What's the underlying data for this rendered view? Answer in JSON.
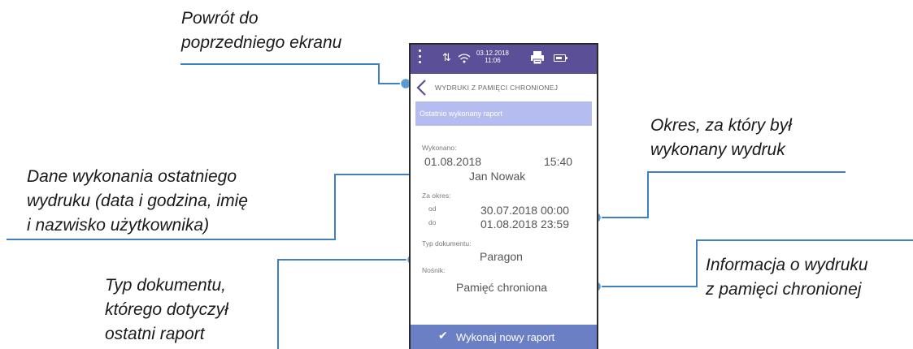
{
  "callouts": {
    "back_1": "Powrót do",
    "back_2": "poprzedniego ekranu",
    "period_1": "Okres, za który był",
    "period_2": "wykonany wydruk",
    "last_1": "Dane wykonania ostatniego",
    "last_2": "wydruku (data i godzina, imię",
    "last_3": "i nazwisko użytkownika)",
    "info_1": "Informacja o wydruku",
    "info_2": "z pamięci chronionej",
    "doctype_1": "Typ dokumentu,",
    "doctype_2": "którego dotyczył",
    "doctype_3": "ostatni raport"
  },
  "statusbar": {
    "date": "03.12.2018",
    "time": "11:06",
    "icons": [
      "menu-icon",
      "data-transfer-icon",
      "wifi-icon",
      "printer-icon",
      "battery-icon"
    ]
  },
  "screen": {
    "title": "WYDRUKI Z PAMIĘCI CHRONIONEJ",
    "section_header": "Ostatnio wykonany raport",
    "executed_label": "Wykonano:",
    "executed_date": "01.08.2018",
    "executed_time": "15:40",
    "user": "Jan Nowak",
    "period_label": "Za okres:",
    "from_label": "od",
    "from_value": "30.07.2018 00:00",
    "to_label": "do",
    "to_value": "01.08.2018 23:59",
    "doc_type_label": "Typ dokumentu:",
    "doc_type_value": "Paragon",
    "medium_label": "Nośnik:",
    "medium_value": "Pamięć chroniona",
    "action_button": "Wykonaj nowy raport"
  },
  "colors": {
    "statusbar": "#5b4f97",
    "section_header": "#b5bdf0",
    "action_button": "#6b7fc4",
    "callout_line": "#3f7fc4"
  }
}
